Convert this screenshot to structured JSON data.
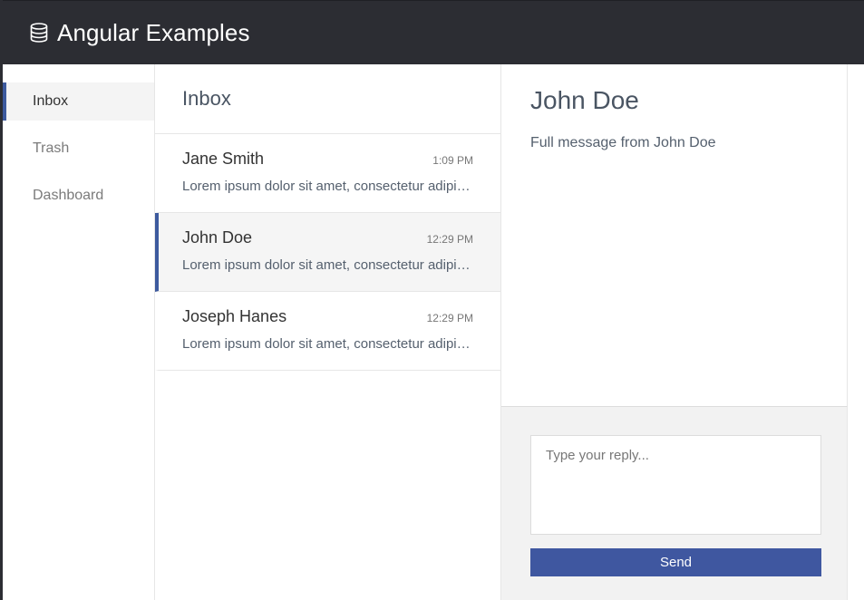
{
  "app": {
    "title": "Angular Examples",
    "logo_icon": "database-icon",
    "accent_color": "#3d5a9e",
    "header_color": "#2c2d33"
  },
  "sidebar": {
    "items": [
      {
        "label": "Inbox",
        "active": true
      },
      {
        "label": "Trash",
        "active": false
      },
      {
        "label": "Dashboard",
        "active": false
      }
    ]
  },
  "inbox": {
    "title": "Inbox",
    "messages": [
      {
        "sender": "Jane Smith",
        "time": "1:09 PM",
        "preview": "Lorem ipsum dolor sit amet, consectetur adipiscing elit",
        "active": false
      },
      {
        "sender": "John Doe",
        "time": "12:29 PM",
        "preview": "Lorem ipsum dolor sit amet, consectetur adipiscing elit",
        "active": true
      },
      {
        "sender": "Joseph Hanes",
        "time": "12:29 PM",
        "preview": "Lorem ipsum dolor sit amet, consectetur adipiscing elit",
        "active": false
      }
    ]
  },
  "detail": {
    "title": "John Doe",
    "body": "Full message from John Doe"
  },
  "reply": {
    "placeholder": "Type your reply...",
    "value": "",
    "send_label": "Send"
  }
}
